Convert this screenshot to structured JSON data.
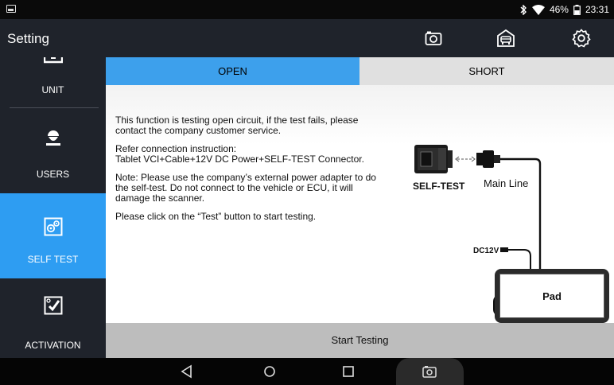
{
  "status_bar": {
    "battery": "46%",
    "time": "23:31",
    "icons": [
      "notification-icon",
      "bluetooth-icon",
      "wifi-icon",
      "battery-icon"
    ]
  },
  "title_bar": {
    "title": "Setting",
    "icons": [
      "camera-icon",
      "garage-icon",
      "settings-icon"
    ]
  },
  "sidebar": {
    "items": [
      {
        "label": "UNIT",
        "icon": "unit-icon"
      },
      {
        "label": "USERS",
        "icon": "user-icon"
      },
      {
        "label": "SELF TEST",
        "icon": "self-test-icon",
        "active": true
      },
      {
        "label": "ACTIVATION",
        "icon": "activation-icon"
      }
    ]
  },
  "tabs": [
    {
      "label": "OPEN",
      "active": true
    },
    {
      "label": "SHORT",
      "active": false
    }
  ],
  "content": {
    "paragraphs": [
      "This function is testing open circuit, if the test fails, please contact the company customer service.",
      "Refer connection instruction:\nTablet VCI+Cable+12V DC Power+SELF-TEST Connector.",
      "Note: Please use the company’s external power adapter to do the self-test. Do not connect to the vehicle or ECU, it will damage the scanner.",
      "Please click on the “Test” button to start testing."
    ],
    "diagram": {
      "self_test_label": "SELF-TEST",
      "main_line_label": "Main Line",
      "dc_label": "DC12V",
      "pad_label": "Pad"
    }
  },
  "start_button": "Start Testing",
  "nav_bar": {
    "icons": [
      "back-icon",
      "home-icon",
      "recents-icon",
      "screenshot-icon"
    ]
  },
  "colors": {
    "accent": "#2e9df2",
    "tab_active": "#3da0ec",
    "sidebar_bg": "#1f232b",
    "start_bar": "#bdbdbd"
  }
}
